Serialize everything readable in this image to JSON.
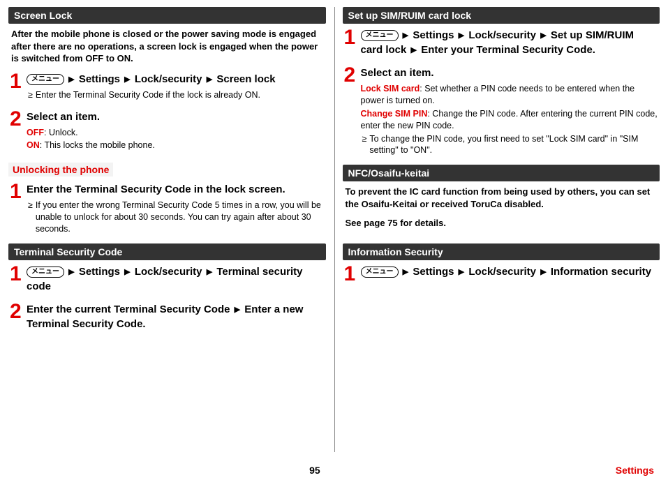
{
  "left": {
    "sec1": {
      "title": "Screen Lock",
      "intro": "After the mobile phone is closed or the power saving mode is engaged after there are no operations, a screen lock is engaged when the power is switched from OFF to ON.",
      "step1": {
        "num": "1",
        "menu": "メニュー",
        "p1": "Settings",
        "p2": "Lock/security",
        "p3": "Screen lock",
        "note": "Enter the Terminal Security Code if the lock is already ON."
      },
      "step2": {
        "num": "2",
        "title": "Select an item.",
        "off_lbl": "OFF",
        "off_txt": ": Unlock.",
        "on_lbl": "ON",
        "on_txt": ": This locks the mobile phone."
      },
      "subhead": "Unlocking the phone",
      "step_u1": {
        "num": "1",
        "title": "Enter the Terminal Security Code in the lock screen.",
        "note": "If you enter the wrong Terminal Security Code 5 times in a row, you will be unable to unlock for about 30 seconds. You can try again after about 30 seconds."
      }
    },
    "sec2": {
      "title": "Terminal Security Code",
      "step1": {
        "num": "1",
        "menu": "メニュー",
        "p1": "Settings",
        "p2": "Lock/security",
        "p3": "Terminal security code"
      },
      "step2": {
        "num": "2",
        "title_a": "Enter the current Terminal Security Code",
        "title_b": "Enter a new Terminal Security Code."
      }
    }
  },
  "right": {
    "sec1": {
      "title": "Set up SIM/RUIM card lock",
      "step1": {
        "num": "1",
        "menu": "メニュー",
        "p1": "Settings",
        "p2": "Lock/security",
        "p3": "Set up SIM/RUIM card lock",
        "p4": "Enter your Terminal Security Code."
      },
      "step2": {
        "num": "2",
        "title": "Select an item.",
        "lock_lbl": "Lock SIM card",
        "lock_txt": ": Set whether a PIN code needs to be entered when the power is turned on.",
        "chg_lbl": "Change SIM PIN",
        "chg_txt": ": Change the PIN code. After entering the current PIN code, enter the new PIN code.",
        "note": "To change the PIN code, you first need to set \"Lock SIM card\" in \"SIM setting\" to \"ON\"."
      }
    },
    "sec2": {
      "title": "NFC/Osaifu-keitai",
      "para1": "To prevent the IC card function from being used by others, you can set the Osaifu-Keitai or received ToruCa disabled.",
      "para2": "See page 75 for details."
    },
    "sec3": {
      "title": "Information Security",
      "step1": {
        "num": "1",
        "menu": "メニュー",
        "p1": "Settings",
        "p2": "Lock/security",
        "p3": "Information security"
      }
    }
  },
  "footer": {
    "page": "95",
    "label": "Settings"
  },
  "glyph": {
    "arrow": "▶",
    "bullet": "≥"
  }
}
